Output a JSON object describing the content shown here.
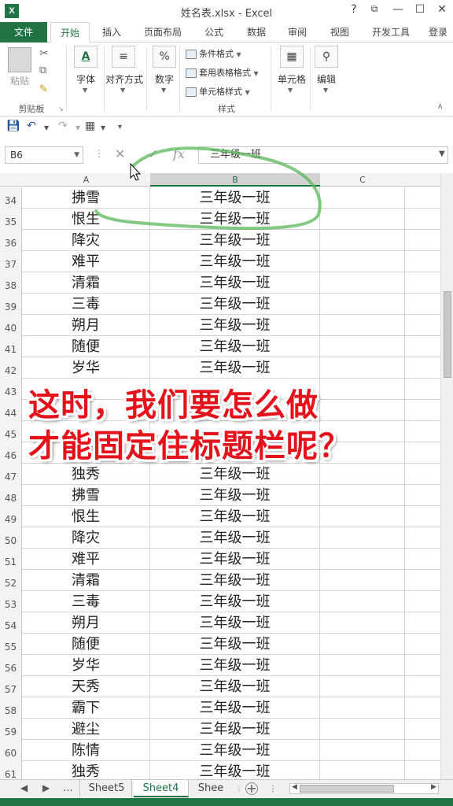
{
  "window": {
    "app_icon": "X",
    "title": "姓名表.xlsx - Excel",
    "help": "?",
    "restore": "⧉",
    "minimize": "—",
    "maximize": "☐",
    "close": "✕"
  },
  "ribbon_tabs": [
    "文件",
    "开始",
    "插入",
    "页面布局",
    "公式",
    "数据",
    "审阅",
    "视图",
    "开发工具",
    "登录"
  ],
  "ribbon": {
    "clipboard": {
      "paste": "粘贴",
      "group": "剪贴板"
    },
    "font": "字体",
    "alignment": "对齐方式",
    "number": "数字",
    "styles": {
      "conditional": "条件格式",
      "table": "套用表格格式",
      "cell_styles": "单元格样式",
      "group": "样式"
    },
    "cells": "单元格",
    "editing": "编辑",
    "number_icon": "%",
    "font_icon": "A"
  },
  "formula_bar": {
    "name_box": "B6",
    "fx": "fx",
    "content": "三年级一班"
  },
  "columns": [
    "A",
    "B",
    "C"
  ],
  "rows": [
    {
      "n": "34",
      "a": "拂雪",
      "b": "三年级一班"
    },
    {
      "n": "35",
      "a": "恨生",
      "b": "三年级一班"
    },
    {
      "n": "36",
      "a": "降灾",
      "b": "三年级一班"
    },
    {
      "n": "37",
      "a": "难平",
      "b": "三年级一班"
    },
    {
      "n": "38",
      "a": "清霜",
      "b": "三年级一班"
    },
    {
      "n": "39",
      "a": "三毒",
      "b": "三年级一班"
    },
    {
      "n": "40",
      "a": "朔月",
      "b": "三年级一班"
    },
    {
      "n": "41",
      "a": "随便",
      "b": "三年级一班"
    },
    {
      "n": "42",
      "a": "岁华",
      "b": "三年级一班"
    },
    {
      "n": "43",
      "a": "",
      "b": ""
    },
    {
      "n": "44",
      "a": "",
      "b": ""
    },
    {
      "n": "45",
      "a": "",
      "b": ""
    },
    {
      "n": "46",
      "a": "陈情",
      "b": ""
    },
    {
      "n": "47",
      "a": "独秀",
      "b": "三年级一班"
    },
    {
      "n": "48",
      "a": "拂雪",
      "b": "三年级一班"
    },
    {
      "n": "49",
      "a": "恨生",
      "b": "三年级一班"
    },
    {
      "n": "50",
      "a": "降灾",
      "b": "三年级一班"
    },
    {
      "n": "51",
      "a": "难平",
      "b": "三年级一班"
    },
    {
      "n": "52",
      "a": "清霜",
      "b": "三年级一班"
    },
    {
      "n": "53",
      "a": "三毒",
      "b": "三年级一班"
    },
    {
      "n": "54",
      "a": "朔月",
      "b": "三年级一班"
    },
    {
      "n": "55",
      "a": "随便",
      "b": "三年级一班"
    },
    {
      "n": "56",
      "a": "岁华",
      "b": "三年级一班"
    },
    {
      "n": "57",
      "a": "天秀",
      "b": "三年级一班"
    },
    {
      "n": "58",
      "a": "霸下",
      "b": "三年级一班"
    },
    {
      "n": "59",
      "a": "避尘",
      "b": "三年级一班"
    },
    {
      "n": "60",
      "a": "陈情",
      "b": "三年级一班"
    },
    {
      "n": "61",
      "a": "独秀",
      "b": "三年级一班"
    }
  ],
  "overlay": {
    "line1": "这时，我们要怎么做",
    "line2": "才能固定住标题栏呢？"
  },
  "sheets": {
    "more": "...",
    "tabs": [
      "Sheet5",
      "Sheet4",
      "Shee"
    ],
    "active": "Sheet4",
    "add": "+"
  },
  "colors": {
    "excel_green": "#217346",
    "caption_red": "#e3121b",
    "annotation_green": "#5bb55b"
  }
}
